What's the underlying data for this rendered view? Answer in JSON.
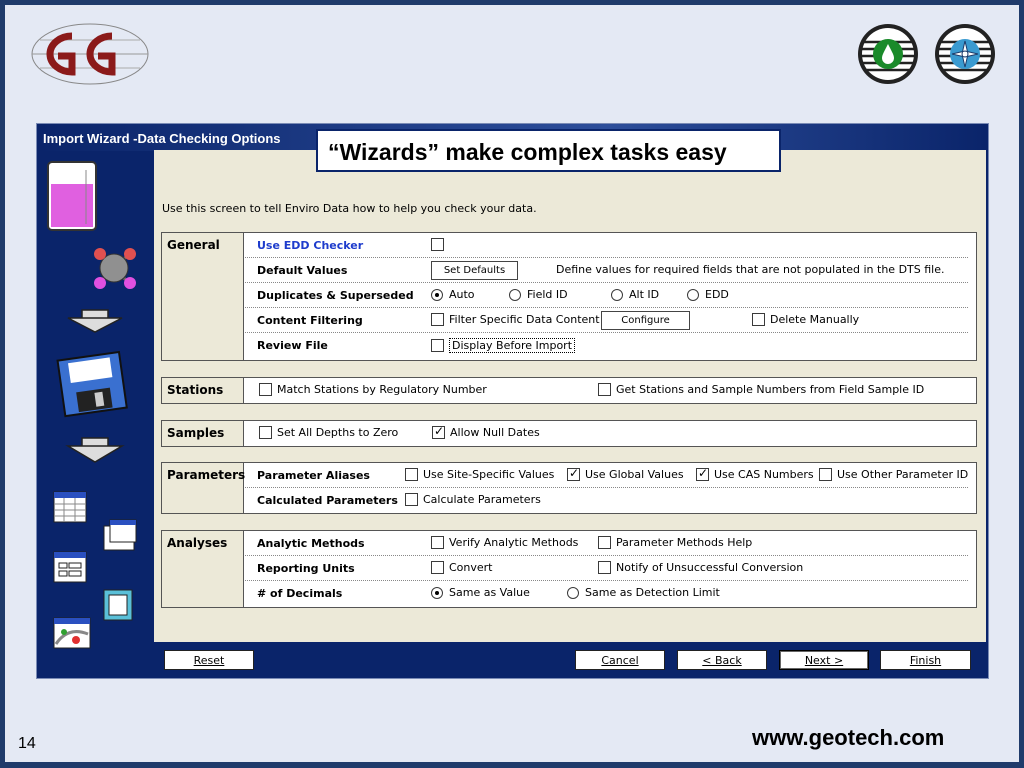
{
  "callout": "“Wizards” make complex tasks easy",
  "window": {
    "title": "Import Wizard -Data Checking Options"
  },
  "intro": "Use this screen to tell Enviro Data how to help you check your data.",
  "groups": {
    "general": {
      "label": "General",
      "use_edd": {
        "label": "Use EDD Checker"
      },
      "default_values": {
        "label": "Default Values",
        "button": "Set Defaults",
        "description": "Define values for required fields that are not populated in the DTS file."
      },
      "duplicates": {
        "label": "Duplicates & Superseded",
        "options": [
          "Auto",
          "Field ID",
          "Alt ID",
          "EDD"
        ]
      },
      "content_filtering": {
        "label": "Content Filtering",
        "filter": "Filter Specific Data Content",
        "button": "Configure",
        "delete": "Delete Manually"
      },
      "review_file": {
        "label": "Review File",
        "display": "Display Before Import"
      }
    },
    "stations": {
      "label": "Stations",
      "match": "Match Stations by Regulatory Number",
      "get": "Get Stations and Sample Numbers from Field Sample ID"
    },
    "samples": {
      "label": "Samples",
      "depths": "Set All Depths to Zero",
      "null_dates": "Allow Null Dates"
    },
    "parameters": {
      "label": "Parameters",
      "aliases": {
        "label": "Parameter Aliases",
        "site": "Use Site-Specific Values",
        "global": "Use Global Values",
        "cas": "Use CAS Numbers",
        "other": "Use Other Parameter ID"
      },
      "calculated": {
        "label": "Calculated Parameters",
        "calc": "Calculate Parameters"
      }
    },
    "analyses": {
      "label": "Analyses",
      "methods": {
        "label": "Analytic Methods",
        "verify": "Verify Analytic Methods",
        "help": "Parameter Methods Help"
      },
      "units": {
        "label": "Reporting Units",
        "convert": "Convert",
        "notify": "Notify of Unsuccessful Conversion"
      },
      "decimals": {
        "label": "# of Decimals",
        "same_value": "Same as Value",
        "same_limit": "Same as Detection Limit"
      }
    }
  },
  "footer": {
    "reset": "Reset",
    "cancel": "Cancel",
    "back": "< Back",
    "next": "Next >",
    "finish": "Finish"
  },
  "page_number": "14",
  "website": "www.geotech.com"
}
